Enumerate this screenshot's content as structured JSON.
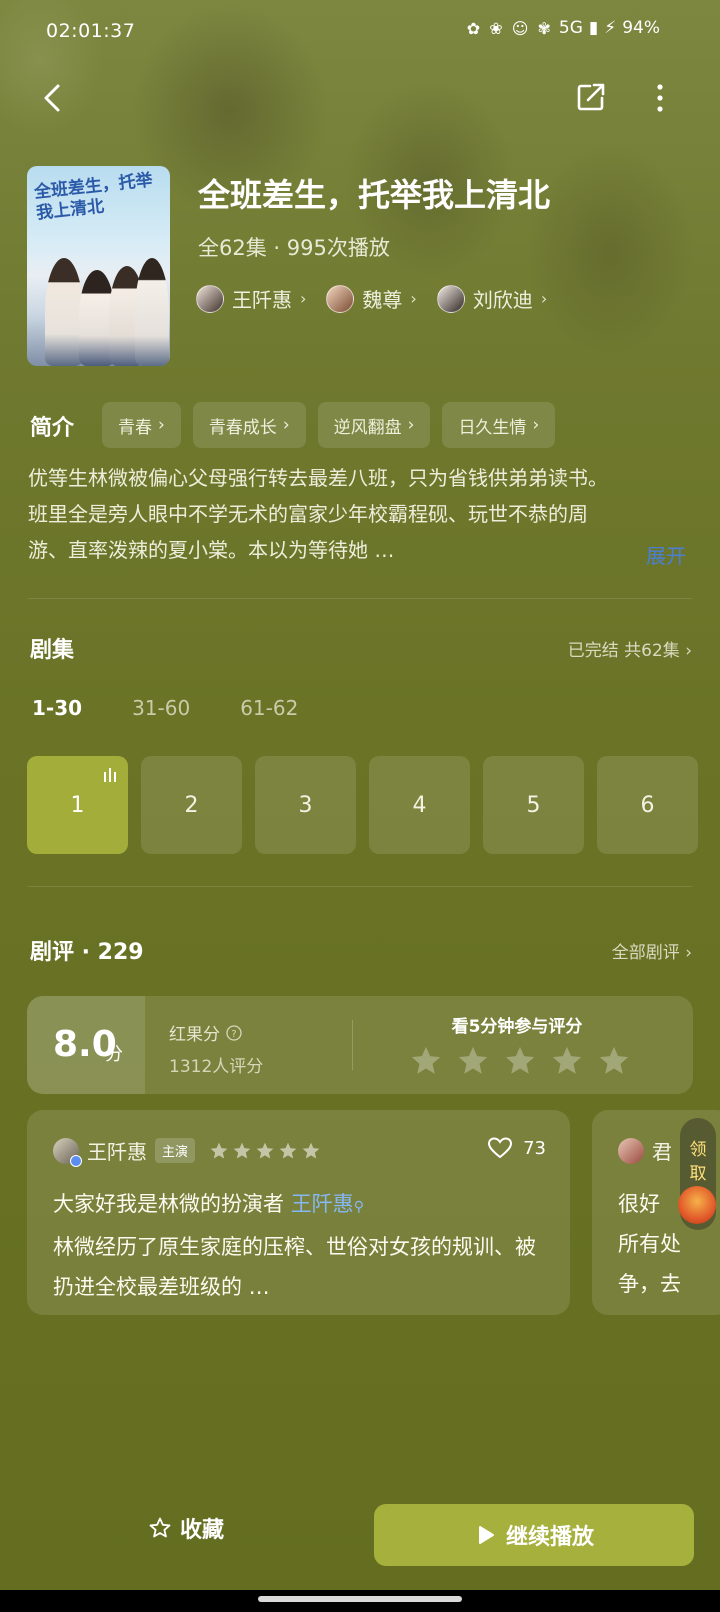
{
  "status": {
    "time": "02:01:37",
    "network": "5G",
    "battery": "94%"
  },
  "icons": {
    "back": "chevron-left-icon",
    "share": "share-icon",
    "more": "more-vertical-icon",
    "star": "star-icon",
    "heart": "heart-icon",
    "play": "play-icon"
  },
  "show": {
    "poster_text": "全班差生，托举我上清北",
    "title": "全班差生，托举我上清北",
    "meta": "全62集 · 995次播放",
    "cast": [
      {
        "name": "王阡惠"
      },
      {
        "name": "魏尊"
      },
      {
        "name": "刘欣迪"
      }
    ]
  },
  "intro": {
    "heading": "简介",
    "tags": [
      "青春",
      "青春成长",
      "逆风翻盘",
      "日久生情"
    ],
    "description": "优等生林微被偏心父母强行转去最差八班，只为省钱供弟弟读书。班里全是旁人眼中不学无术的富家少年校霸程砚、玩世不恭的周游、直率泼辣的夏小棠。本以为等待她 …",
    "expand": "展开"
  },
  "episodes": {
    "heading": "剧集",
    "status": "已完结 共62集",
    "tabs": [
      "1-30",
      "31-60",
      "61-62"
    ],
    "active_tab": 0,
    "items": [
      "1",
      "2",
      "3",
      "4",
      "5",
      "6"
    ],
    "active_item": 0
  },
  "reviews": {
    "heading": "剧评 · 229",
    "all": "全部剧评",
    "score": "8.0",
    "score_unit": "分",
    "score_label": "红果分",
    "score_count": "1312人评分",
    "rate_prompt": "看5分钟参与评分",
    "cards": [
      {
        "name": "王阡惠",
        "badge": "主演",
        "rating": 5,
        "likes": "73",
        "body_prefix": "大家好我是林微的扮演者",
        "mention": "王阡惠",
        "body_rest": "林微经历了原生家庭的压榨、世俗对女孩的规训、被扔进全校最差班级的 …"
      },
      {
        "name": "君",
        "body_lines": [
          "很好",
          "所有处",
          "争，去"
        ]
      }
    ]
  },
  "reward": {
    "label_1": "领",
    "label_2": "取"
  },
  "bottom": {
    "favorite": "收藏",
    "continue": "继续播放"
  }
}
